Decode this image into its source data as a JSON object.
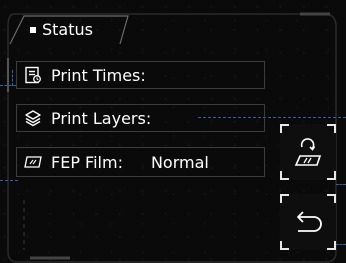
{
  "panel": {
    "tab_label": "Status"
  },
  "rows": [
    {
      "label": "Print Times:",
      "value": "",
      "icon": "print-times-icon"
    },
    {
      "label": "Print Layers:",
      "value": "",
      "icon": "layers-icon"
    },
    {
      "label": "FEP Film:",
      "value": "Normal",
      "icon": "fep-film-icon"
    }
  ],
  "buttons": {
    "fep_reset": {
      "icon": "fep-reset-icon"
    },
    "back": {
      "icon": "back-arrow-icon"
    }
  },
  "colors": {
    "background": "#0a0a0a",
    "border": "#3c3c3c",
    "dashed_accent": "#3a5fa8",
    "text": "#ffffff"
  }
}
